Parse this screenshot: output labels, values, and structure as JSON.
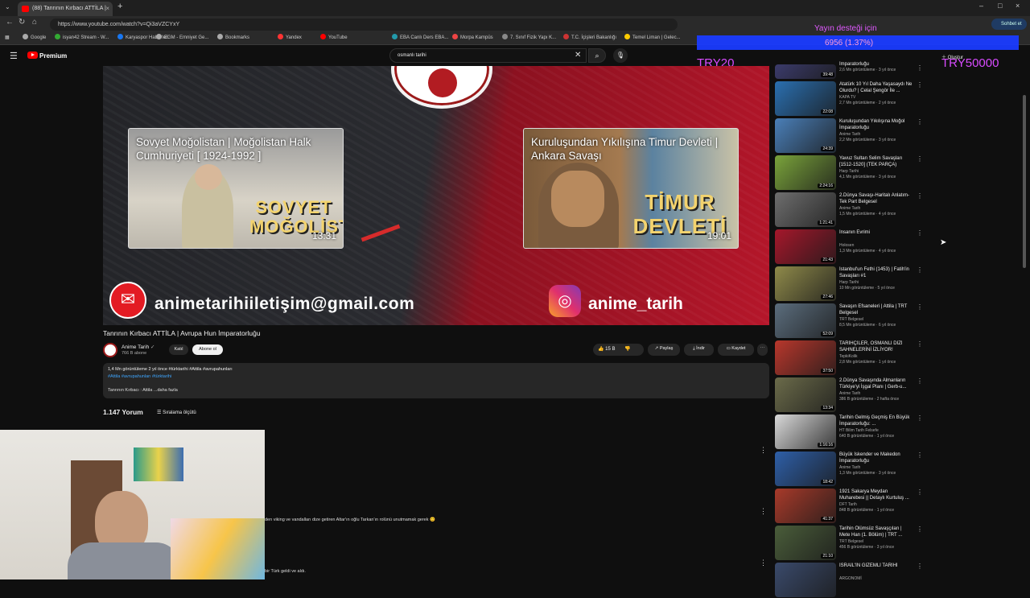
{
  "browser": {
    "tab_title": "(88) Tanrının Kırbacı ATTİLA |",
    "tab_close": "×",
    "new_tab": "+",
    "url": "https://www.youtube.com/watch?v=Qi3aVZCYxY",
    "window_controls": [
      "–",
      "□",
      "×"
    ],
    "bookmarks": [
      "Google",
      "isyan42 Stream - W...",
      "Karyaspor Haberleri",
      "EGM - Emniyet Ge...",
      "Bookmarks",
      "Yandex",
      "YouTube",
      "EBA Canlı Ders EBA...",
      "Morpa Kampüs",
      "7. Sınıf Fizik Yapı K...",
      "T.C. İçişleri Bakanlığı",
      "Temel Liman | Gelec..."
    ],
    "profile_label": "Sohbet et"
  },
  "overlay": {
    "goal_text": "Yayın desteği için",
    "goal_progress": "6956 (1.37%)",
    "code_left": "TRY20",
    "code_right": "TRY50000",
    "accent": "#1a3bff"
  },
  "header": {
    "logo_label": "Premium",
    "search_value": "osmanlı tarihi",
    "create_label": "Oluştur"
  },
  "player": {
    "card1_title": "Sovyet Moğolistan | Moğolistan Halk Cumhuriyeti [ 1924-1992 ]",
    "card1_big": "SOVYET MOĞOLİSTAN",
    "card1_duration": "13:31",
    "card2_title": "Kuruluşundan Yıkılışına Timur Devleti | Ankara Savaşı",
    "card2_big": "TİMUR DEVLETİ",
    "card2_duration": "19:01",
    "email": "animetarihiiletişim@gmail.com",
    "instagram": "anime_tarih"
  },
  "video": {
    "title": "Tanrının Kırbacı ATTİLA | Avrupa Hun İmparatorluğu",
    "channel": "Anime Tarih",
    "subscribers": "766 B abone",
    "join_label": "Katıl",
    "subscribe_label": "Abone ol",
    "likes": "15 B",
    "share_label": "Paylaş",
    "download_label": "İndir",
    "save_label": "Kaydet",
    "desc_meta": "1,4 Mn görüntüleme  2 yıl önce  #türktarihi #Attila #avrupahunları",
    "desc_tags": "#Attila #avrupahunları #türktarihi",
    "desc_text": "Tanrının Kırbacı : Attila ...daha fazla"
  },
  "comments": {
    "count": "1.147 Yorum",
    "sort_label": "Sıralama ölçütü",
    "comment1": "den viking ve vandalları dize getiren Altar'ın oğlu Tarkan'ın rolünü unutmamak gerek 😊",
    "comment2": "bir Türk geldi ve aldı."
  },
  "sidebar": {
    "items": [
      {
        "title": "İmparatorluğu",
        "channel": "",
        "meta": "2,6 Mn görüntüleme · 3 yıl önce",
        "duration": "39:48",
        "color": "#3b3b6b"
      },
      {
        "title": "Atatürk 10 Yıl Daha Yaşasaydı Ne Olurdu? | Celal Şengör İle ...",
        "channel": "KAPA TV",
        "meta": "2,7 Mn görüntüleme · 2 yıl önce",
        "duration": "22:08",
        "color": "#2a6fb0"
      },
      {
        "title": "Kuruluşundan Yıkılışına Moğol İmparatorluğu",
        "channel": "Anime Tarih",
        "meta": "2,2 Mn görüntüleme · 3 yıl önce",
        "duration": "24:39",
        "color": "#4a7fb8"
      },
      {
        "title": "Yavuz Sultan Selim Savaşları [1512-1520] (TEK PARÇA)",
        "channel": "Harp Tarihi",
        "meta": "4,1 Mn görüntüleme · 3 yıl önce",
        "duration": "2:24:16",
        "color": "#7aa33b"
      },
      {
        "title": "2.Dünya Savaşı-Haritalı Anlatım-Tek Part Belgesel",
        "channel": "Anime Tarih",
        "meta": "1,5 Mn görüntüleme · 4 yıl önce",
        "duration": "1:21:41",
        "color": "#6e6e6e"
      },
      {
        "title": "İnsanın Evrimi",
        "channel": "Holosen",
        "meta": "1,3 Mn görüntüleme · 4 yıl önce",
        "duration": "21:43",
        "color": "#a5172b"
      },
      {
        "title": "İstanbul'un Fethi (1453) | Fatih'in Savaşları #1",
        "channel": "Harp Tarihi",
        "meta": "10 Mn görüntüleme · 5 yıl önce",
        "duration": "27:46",
        "color": "#8f8a4a"
      },
      {
        "title": "Savaşın Efsaneleri | Attila | TRT Belgesel",
        "channel": "TRT Belgesel",
        "meta": "8,5 Mn görüntüleme · 6 yıl önce",
        "duration": "52:09",
        "color": "#5b6d7d"
      },
      {
        "title": "TARİHÇİLER, OSMANLI DİZİ SAHNELERİNİ İZLİYOR!",
        "channel": "TepkiKolik",
        "meta": "2,8 Mn görüntüleme · 1 yıl önce",
        "duration": "37:50",
        "color": "#b8372c"
      },
      {
        "title": "2.Dünya Savaşında Almanların Türkiye'yi İşgal Planı | Gerb-u...",
        "channel": "Anime Tarih",
        "meta": "386 B görüntüleme · 2 hafta önce",
        "duration": "13:34",
        "color": "#6b6b4a"
      },
      {
        "title": "Tarihin Gelmiş Geçmiş En Büyük İmparatorluğu: ...",
        "channel": "HT Bilim Tarih Felsefe",
        "meta": "640 B görüntüleme · 1 yıl önce",
        "duration": "1:16:16",
        "color": "#d9d9d9"
      },
      {
        "title": "Büyük İskender ve Makedon İmparatorluğu",
        "channel": "Anime Tarih",
        "meta": "1,3 Mn görüntüleme · 3 yıl önce",
        "duration": "18:42",
        "color": "#2e5fa8"
      },
      {
        "title": "1921 Sakarya Meydan Muharebesi || Detaylı Kurtuluş ...",
        "channel": "DFT Tarih",
        "meta": "848 B görüntüleme · 1 yıl önce",
        "duration": "41:37",
        "color": "#a83a2a"
      },
      {
        "title": "Tarihin Ölümsüz Savaşçıları | Mete Han (1. Bölüm) | TRT ...",
        "channel": "TRT Belgesel",
        "meta": "456 B görüntüleme · 3 yıl önce",
        "duration": "21:10",
        "color": "#4a5d3a"
      },
      {
        "title": "İSRAİL'İN GİZEMLİ TARİHİ",
        "channel": "ARGONOMİ",
        "meta": "",
        "duration": "",
        "color": "#3a4a6b"
      }
    ]
  }
}
